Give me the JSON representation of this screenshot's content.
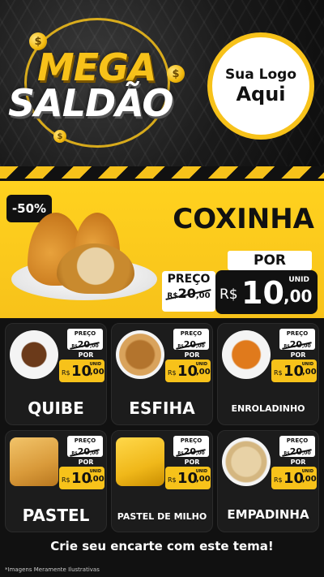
{
  "header": {
    "headline_1": "MEGA",
    "headline_2": "SALDÃO",
    "logo_line_1": "Sua Logo",
    "logo_line_2": "Aqui",
    "coin_symbol": "$"
  },
  "featured": {
    "discount": "-50%",
    "name": "COXINHA",
    "por_label": "POR",
    "preco_label": "PREÇO",
    "old_price_currency": "R$",
    "old_price_whole": "20",
    "old_price_cents": ",00",
    "unit_label": "UNID",
    "currency": "R$",
    "price_whole": "10",
    "price_cents": ",00"
  },
  "products": [
    {
      "name": "QUIBE",
      "preco_label": "PREÇO",
      "old_currency": "R$",
      "old_whole": "20",
      "old_cents": ",00",
      "por_label": "POR",
      "unit_label": "UNID",
      "currency": "R$",
      "whole": "10",
      "cents": ",00"
    },
    {
      "name": "ESFIHA",
      "preco_label": "PREÇO",
      "old_currency": "R$",
      "old_whole": "20",
      "old_cents": ",00",
      "por_label": "POR",
      "unit_label": "UNID",
      "currency": "R$",
      "whole": "10",
      "cents": ",00"
    },
    {
      "name": "ENROLADINHO",
      "preco_label": "PREÇO",
      "old_currency": "R$",
      "old_whole": "20",
      "old_cents": ",00",
      "por_label": "POR",
      "unit_label": "UNID",
      "currency": "R$",
      "whole": "10",
      "cents": ",00"
    },
    {
      "name": "PASTEL",
      "preco_label": "PREÇO",
      "old_currency": "R$",
      "old_whole": "20",
      "old_cents": ",00",
      "por_label": "POR",
      "unit_label": "UNID",
      "currency": "R$",
      "whole": "10",
      "cents": ",00"
    },
    {
      "name": "PASTEL DE MILHO",
      "preco_label": "PREÇO",
      "old_currency": "R$",
      "old_whole": "20",
      "old_cents": ",00",
      "por_label": "POR",
      "unit_label": "UNID",
      "currency": "R$",
      "whole": "10",
      "cents": ",00"
    },
    {
      "name": "EMPADINHA",
      "preco_label": "PREÇO",
      "old_currency": "R$",
      "old_whole": "20",
      "old_cents": ",00",
      "por_label": "POR",
      "unit_label": "UNID",
      "currency": "R$",
      "whole": "10",
      "cents": ",00"
    }
  ],
  "footer": {
    "cta": "Crie seu encarte com este tema!",
    "disclaimer": "*Imagens Meramente Ilustrativas"
  },
  "colors": {
    "accent_yellow": "#f7c21a",
    "background_dark": "#111111",
    "card_dark": "#1c1c1c"
  },
  "icons": [
    "coin-icon",
    "coxinha-food-image",
    "quibe-food-image",
    "esfiha-food-image",
    "enroladinho-food-image",
    "pastel-food-image",
    "pastel-de-milho-food-image",
    "empadinha-food-image"
  ]
}
